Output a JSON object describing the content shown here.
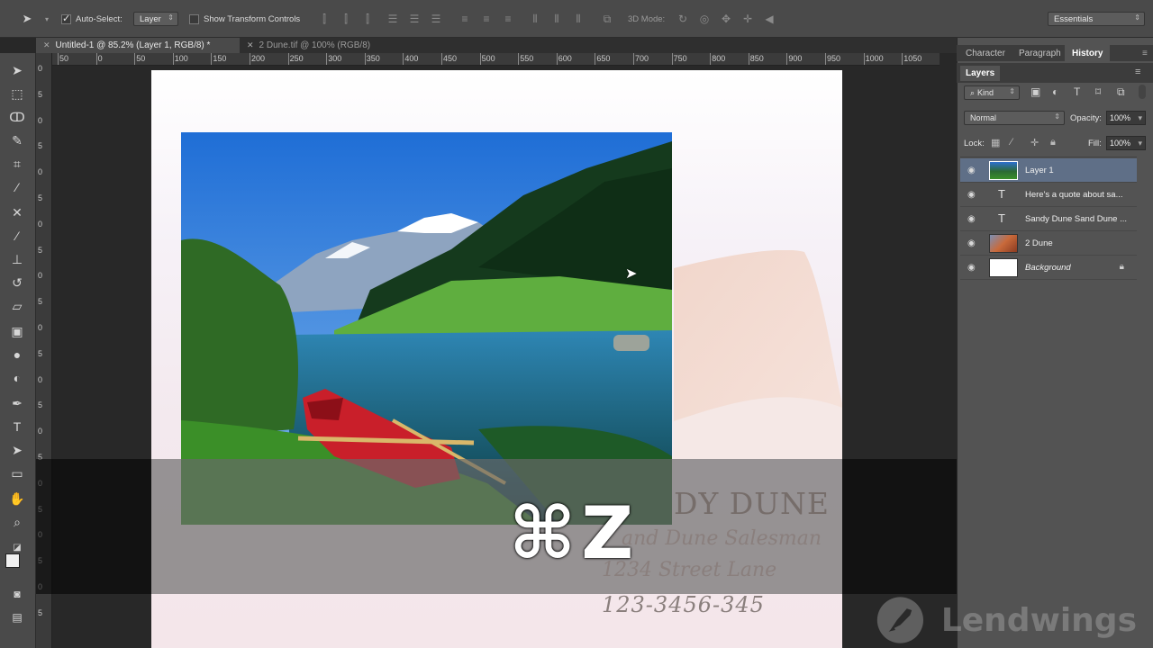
{
  "options_bar": {
    "auto_select_label": "Auto-Select:",
    "auto_select_value": "Layer",
    "show_transform_label": "Show Transform Controls",
    "mode_3d_label": "3D Mode:",
    "workspace_value": "Essentials"
  },
  "document_tabs": [
    {
      "label": "Untitled-1 @ 85.2% (Layer 1, RGB/8) *",
      "active": true
    },
    {
      "label": "2 Dune.tif @ 100% (RGB/8)",
      "active": false
    }
  ],
  "ruler_top_labels": [
    "50",
    "0",
    "50",
    "100",
    "150",
    "200",
    "250",
    "300",
    "350",
    "400",
    "450",
    "500",
    "550",
    "600",
    "650",
    "700",
    "750",
    "800",
    "850",
    "900",
    "950",
    "1000",
    "1050"
  ],
  "ruler_left_labels": [
    "0",
    "5",
    "0",
    "5",
    "0",
    "5",
    "0",
    "5",
    "0",
    "5",
    "0",
    "5",
    "0",
    "5",
    "0",
    "5",
    "0",
    "5",
    "0",
    "5",
    "0",
    "5"
  ],
  "tools": [
    "move-tool",
    "marquee-tool",
    "lasso-tool",
    "quick-select-tool",
    "crop-tool",
    "eyedropper-tool",
    "healing-tool",
    "brush-tool",
    "stamp-tool",
    "history-brush-tool",
    "eraser-tool",
    "gradient-tool",
    "blur-tool",
    "dodge-tool",
    "pen-tool",
    "type-tool",
    "path-select-tool",
    "shape-tool",
    "hand-tool",
    "zoom-tool"
  ],
  "document": {
    "line1": "DY DUNE",
    "line2": "and Dune Salesman",
    "line3": "1234 Street Lane",
    "line4": "123-3456-345"
  },
  "shortcut_overlay": {
    "symbol": "⌘",
    "key": "Z"
  },
  "right_panel": {
    "tabs": [
      {
        "label": "Character",
        "active": false
      },
      {
        "label": "Paragraph",
        "active": false
      },
      {
        "label": "History",
        "active": true
      }
    ],
    "layers_title": "Layers",
    "filter_kind": "Kind",
    "blend_mode": "Normal",
    "opacity_label": "Opacity:",
    "opacity_value": "100%",
    "lock_label": "Lock:",
    "fill_label": "Fill:",
    "fill_value": "100%",
    "layers": [
      {
        "name": "Layer 1",
        "type": "image",
        "selected": true
      },
      {
        "name": "Here's a quote about sa...",
        "type": "text",
        "selected": false
      },
      {
        "name": "Sandy Dune Sand Dune ...",
        "type": "text",
        "selected": false
      },
      {
        "name": "2 Dune",
        "type": "image",
        "selected": false
      },
      {
        "name": "Background",
        "type": "background",
        "selected": false
      }
    ]
  },
  "watermark": {
    "text": "Lendwings"
  },
  "colors": {
    "selection": "#5f6f87",
    "panel": "#535353",
    "toolbar": "#4a4a4a"
  }
}
